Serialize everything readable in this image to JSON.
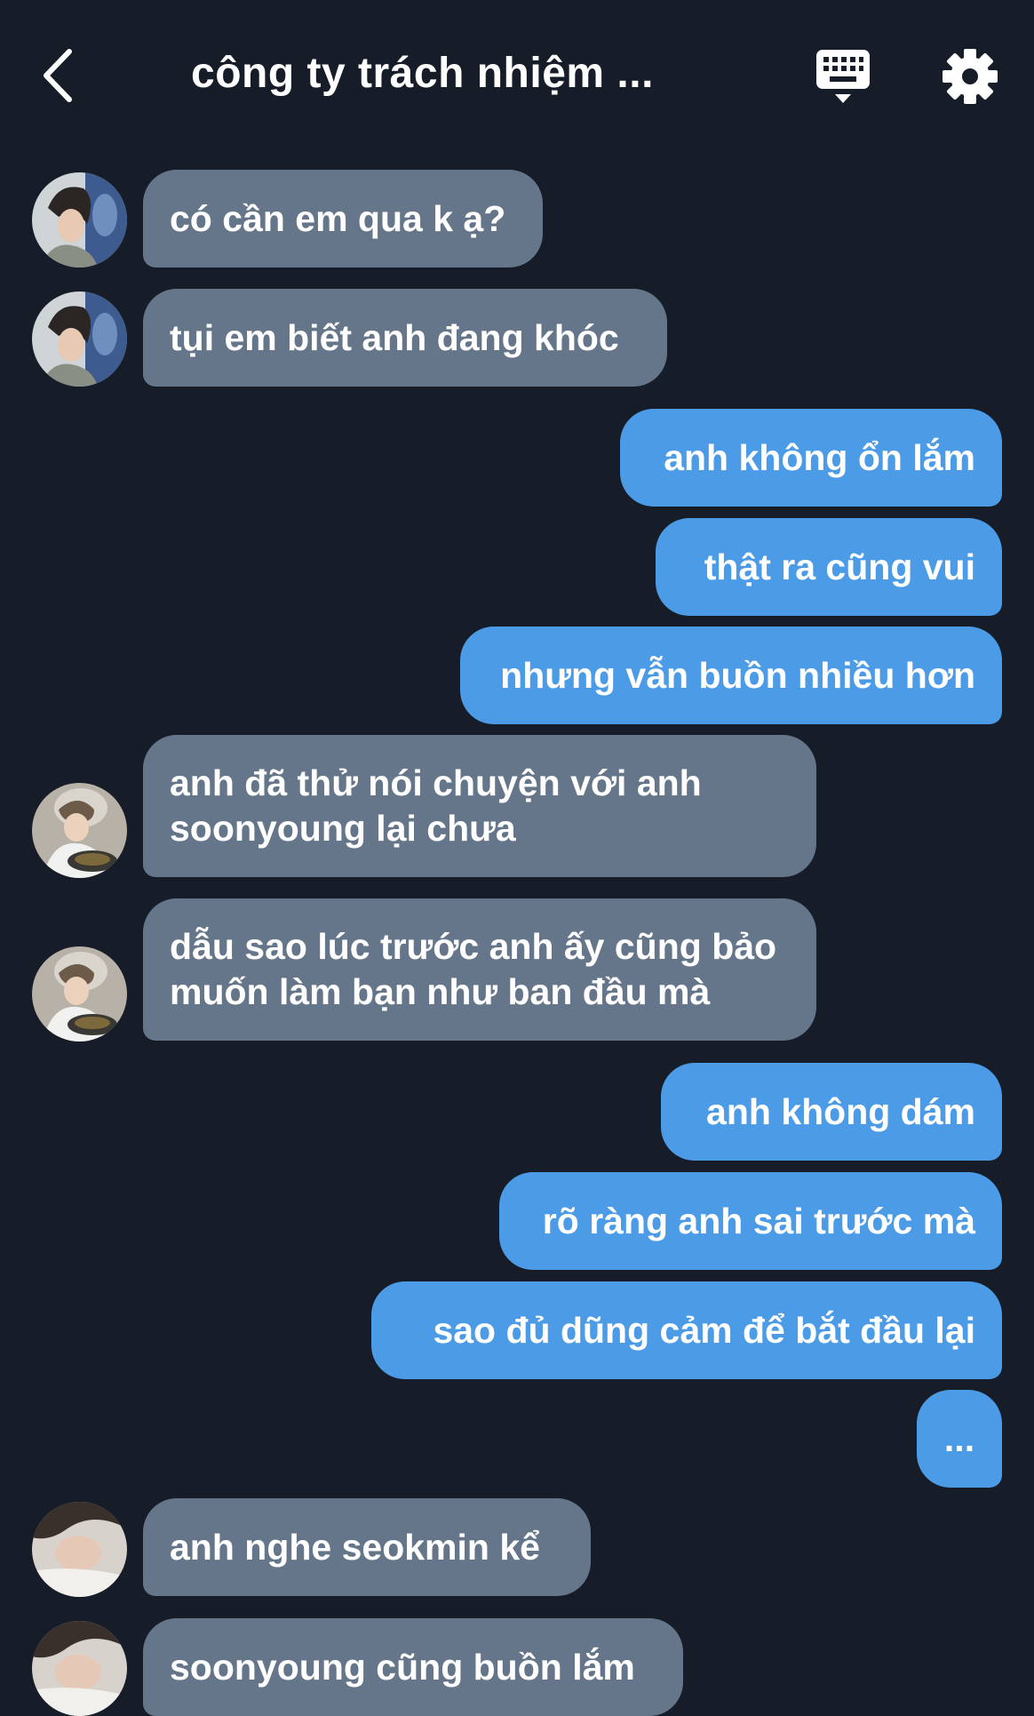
{
  "header": {
    "title": "công ty trách nhiệm ...",
    "back_icon": "chevron-left-icon",
    "keyboard_icon": "keyboard-icon",
    "settings_icon": "gear-icon"
  },
  "colors": {
    "background": "#161d28",
    "incoming_bubble": "#66768a",
    "outgoing_bubble": "#4b9be7",
    "text": "#ffffff"
  },
  "messages": [
    {
      "direction": "incoming",
      "text": "có cần em qua k ạ?",
      "avatar": "avatar-1"
    },
    {
      "direction": "incoming",
      "text": "tụi em biết anh đang khóc",
      "avatar": "avatar-1"
    },
    {
      "direction": "outgoing",
      "text": "anh không ổn lắm"
    },
    {
      "direction": "outgoing",
      "text": "thật ra cũng vui"
    },
    {
      "direction": "outgoing",
      "text": "nhưng vẫn buồn nhiều hơn"
    },
    {
      "direction": "incoming",
      "text": "anh đã thử nói chuyện với anh\nsoonyoung lại chưa",
      "avatar": "avatar-2"
    },
    {
      "direction": "incoming",
      "text": "dẫu sao lúc trước anh ấy cũng bảo\nmuốn làm bạn như ban đầu mà",
      "avatar": "avatar-2"
    },
    {
      "direction": "outgoing",
      "text": "anh không dám"
    },
    {
      "direction": "outgoing",
      "text": "rõ ràng anh sai trước mà"
    },
    {
      "direction": "outgoing",
      "text": "sao đủ dũng cảm để bắt đầu lại"
    },
    {
      "direction": "outgoing",
      "text": "..."
    },
    {
      "direction": "incoming",
      "text": "anh nghe seokmin kể",
      "avatar": "avatar-3"
    },
    {
      "direction": "incoming",
      "text": "soonyoung cũng buồn lắm",
      "avatar": "avatar-3"
    }
  ]
}
